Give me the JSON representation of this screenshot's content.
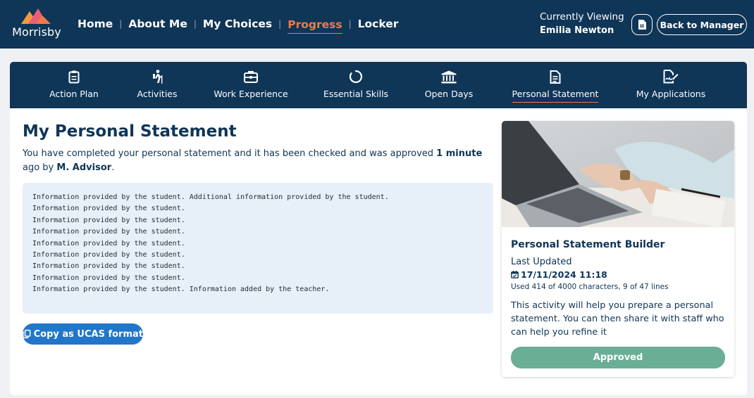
{
  "brand": {
    "name": "Morrisby"
  },
  "topnav": {
    "items": [
      {
        "label": "Home",
        "active": false
      },
      {
        "label": "About Me",
        "active": false
      },
      {
        "label": "My Choices",
        "active": false
      },
      {
        "label": "Progress",
        "active": true
      },
      {
        "label": "Locker",
        "active": false
      }
    ],
    "separator": "|"
  },
  "viewing": {
    "label": "Currently Viewing",
    "name": "Emilia Newton"
  },
  "actions": {
    "doc_icon": "document-icon",
    "back_label": "Back to Manager"
  },
  "subnav": {
    "items": [
      {
        "label": "Action Plan",
        "icon": "clipboard-list-icon"
      },
      {
        "label": "Activities",
        "icon": "hiker-icon"
      },
      {
        "label": "Work Experience",
        "icon": "briefcase-icon"
      },
      {
        "label": "Essential Skills",
        "icon": "circle-progress-icon"
      },
      {
        "label": "Open Days",
        "icon": "building-columns-icon"
      },
      {
        "label": "Personal Statement",
        "icon": "file-text-icon",
        "active": true
      },
      {
        "label": "My Applications",
        "icon": "file-signature-icon"
      }
    ]
  },
  "main": {
    "title": "My Personal Statement",
    "status": {
      "part1": "You have completed your personal statement and it has been checked and was approved ",
      "time": "1 minute",
      "part2": " ago by ",
      "advisor": "M. Advisor",
      "part3": "."
    },
    "statement_lines": [
      "Information provided by the student. Additional information provided by the student.",
      "Information provided by the student.",
      "Information provided by the student.",
      "Information provided by the student.",
      "Information provided by the student.",
      "Information provided by the student.",
      "Information provided by the student.",
      "Information provided by the student.",
      "Information provided by the student. Information added by the teacher."
    ],
    "copy_button": "Copy as UCAS format"
  },
  "side": {
    "title": "Personal Statement Builder",
    "last_updated_label": "Last Updated",
    "date": "17/11/2024 11:18",
    "usage": "Used 414 of 4000 characters, 9 of 47 lines",
    "description": "This activity will help you prepare a personal statement. You can then share it with staff who can help you refine it",
    "status_label": "Approved"
  },
  "colors": {
    "navy": "#0f3557",
    "accent_orange": "#f07a45",
    "button_blue": "#2176c9",
    "approved_green": "#6aae95",
    "statement_bg": "#e7eff9"
  }
}
